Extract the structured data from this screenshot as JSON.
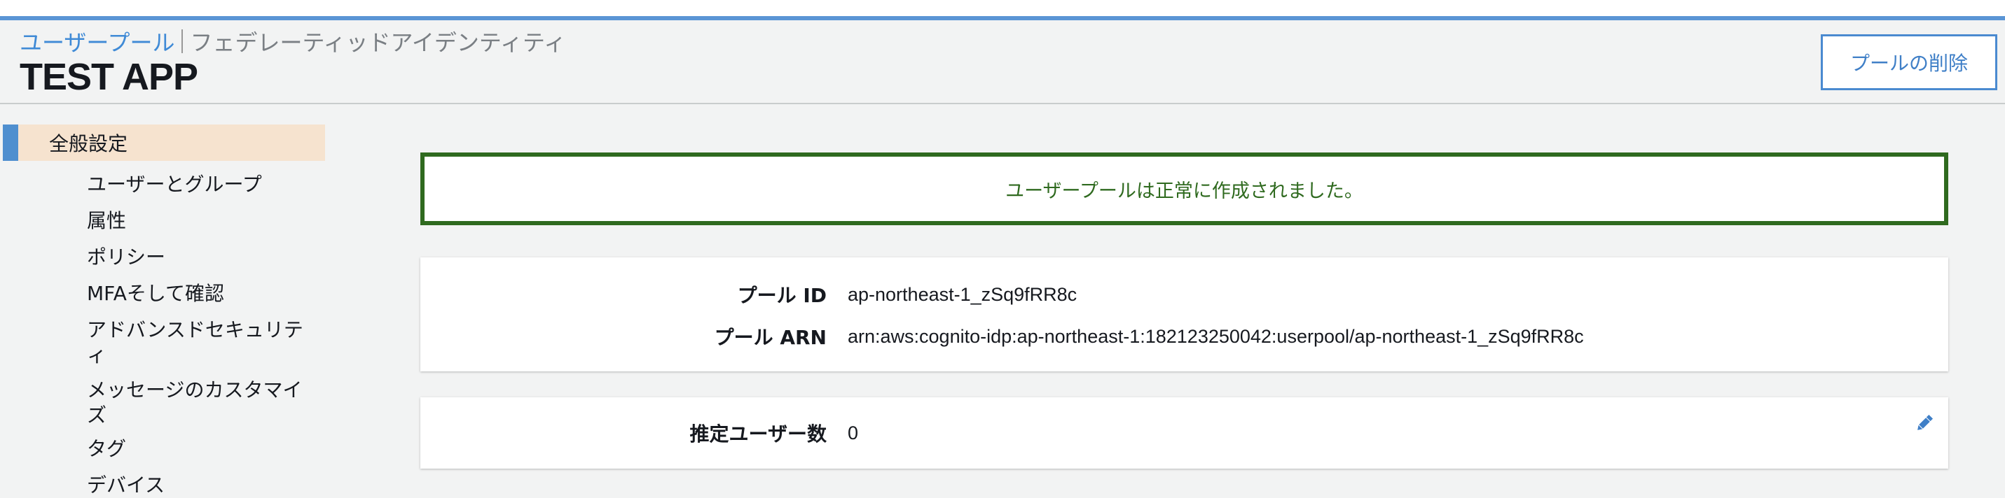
{
  "breadcrumb": {
    "link": "ユーザープール",
    "current": "フェデレーティッドアイデンティティ"
  },
  "page_title": "TEST APP",
  "delete_button": "プールの削除",
  "sidebar": {
    "active": "全般設定",
    "items": [
      "ユーザーとグループ",
      "属性",
      "ポリシー",
      "MFAそして確認",
      "アドバンスドセキュリティ",
      "メッセージのカスタマイズ",
      "タグ",
      "デバイス"
    ]
  },
  "alert": {
    "message": "ユーザープールは正常に作成されました。"
  },
  "pool_info": {
    "id_label": "プール ID",
    "id_value": "ap-northeast-1_zSq9fRR8c",
    "arn_label": "プール ARN",
    "arn_value": "arn:aws:cognito-idp:ap-northeast-1:182123250042:userpool/ap-northeast-1_zSq9fRR8c"
  },
  "estimate": {
    "label": "推定ユーザー数",
    "value": "0"
  },
  "colors": {
    "accent": "#5a95d5",
    "link": "#3f8ad6",
    "success": "#2f6a1f",
    "active_nav_bg": "#f6e3cf"
  },
  "icons": [
    "pencil-icon"
  ]
}
